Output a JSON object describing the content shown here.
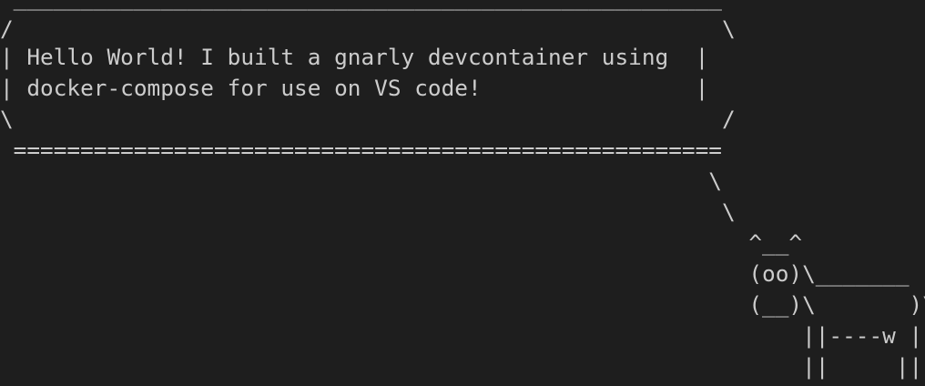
{
  "terminal": {
    "lines": [
      " _____________________________________________________",
      "/                                                     \\",
      "| Hello World! I built a gnarly devcontainer using  |",
      "| docker-compose for use on VS code!                |",
      "\\                                                     /",
      " =====================================================",
      "                                                     \\",
      "                                                      \\",
      "                                                        ^__^",
      "                                                        (oo)\\_______",
      "                                                        (__)\\       )\\/\\",
      "                                                            ||----w |",
      "                                                            ||     ||"
    ]
  }
}
